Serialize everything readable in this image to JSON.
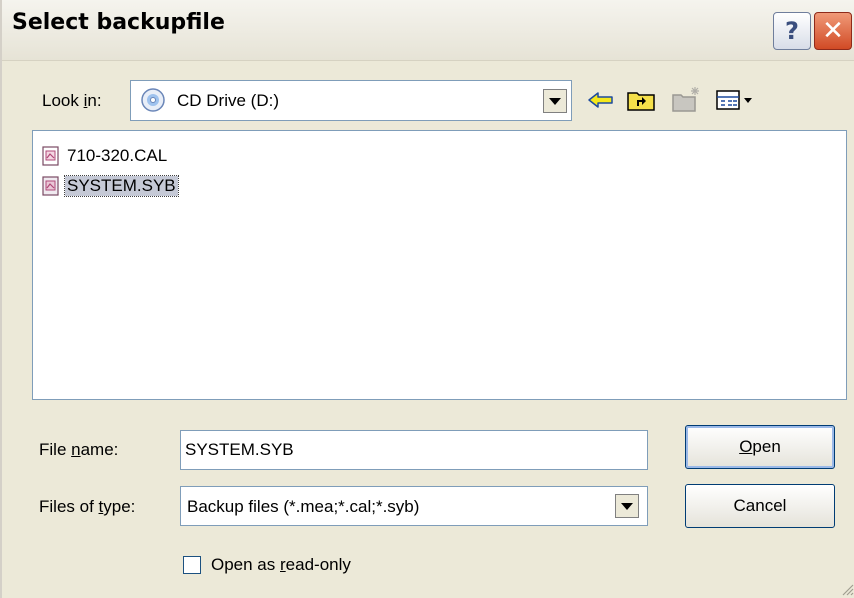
{
  "window": {
    "title": "Select backupfile",
    "help_glyph": "?",
    "close_glyph": "✕"
  },
  "lookin": {
    "label_pre": "Look ",
    "label_key": "i",
    "label_post": "n:",
    "value": "CD Drive (D:)",
    "icon": "cd-drive-icon"
  },
  "toolbar": {
    "back_icon": "back-arrow-icon",
    "up_icon": "up-one-level-icon",
    "new_folder_icon": "new-folder-icon",
    "view_icon": "view-menu-icon"
  },
  "files": [
    {
      "name": "710-320.CAL",
      "icon": "file-icon",
      "selected": false
    },
    {
      "name": "SYSTEM.SYB",
      "icon": "file-icon",
      "selected": true
    }
  ],
  "filename": {
    "label_pre": "File ",
    "label_key": "n",
    "label_post": "ame:",
    "value": "SYSTEM.SYB"
  },
  "filetype": {
    "label_pre": "Files of ",
    "label_key": "t",
    "label_post": "ype:",
    "value": "Backup files (*.mea;*.cal;*.syb)"
  },
  "buttons": {
    "open_key": "O",
    "open_rest": "pen",
    "cancel": "Cancel"
  },
  "readonly": {
    "checked": false,
    "label_pre": "Open as ",
    "label_key": "r",
    "label_post": "ead-only"
  },
  "colors": {
    "dialog_bg": "#ece9d8",
    "selection": "#c5c9d6",
    "close_button": "#d14a25"
  }
}
